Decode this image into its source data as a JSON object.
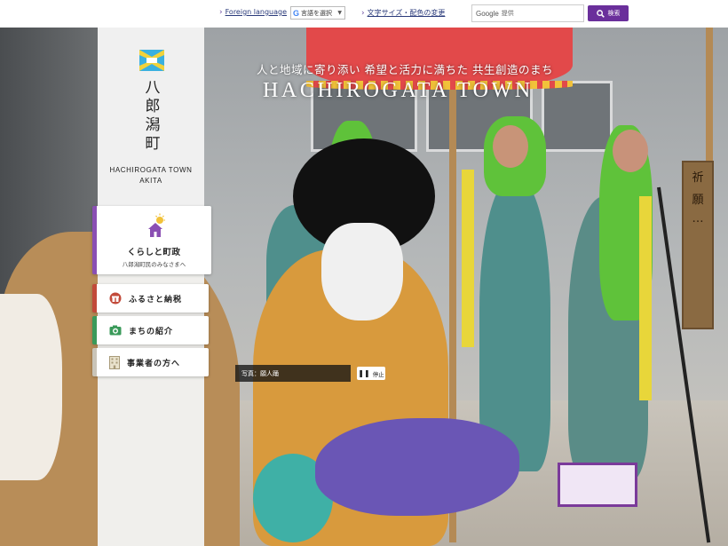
{
  "header": {
    "foreign_language": "Foreign language",
    "translate_label": "言語を選択",
    "translate_arrow": "▼",
    "accessibility_link": "文字サイズ・配色の変更",
    "search": {
      "brand": "Google",
      "placeholder": "提供",
      "button_label": "検索"
    }
  },
  "site": {
    "name_vertical": [
      "八",
      "郎",
      "潟",
      "町"
    ],
    "name_en_line1": "HACHIROGATA TOWN",
    "name_en_line2": "AKITA"
  },
  "hero": {
    "catch_jp": "人と地域に寄り添い 希望と活力に満ちた 共生創造のまち",
    "catch_en": "HACHIROGATA TOWN",
    "photo_credit": "写真：願人踊",
    "pause_label": "停止",
    "sign_text": [
      "祈",
      "願",
      "…"
    ]
  },
  "nav": {
    "main": {
      "title": "くらしと町政",
      "subtitle": "八郎潟町民のみなさまへ"
    },
    "items": [
      {
        "label": "ふるさと納税",
        "icon": "gift-icon",
        "accent": "#c24a3a"
      },
      {
        "label": "まちの紹介",
        "icon": "camera-icon",
        "accent": "#3a9a5a"
      },
      {
        "label": "事業者の方へ",
        "icon": "building-icon",
        "accent": "#c9c4b8"
      }
    ]
  },
  "colors": {
    "brand_purple": "#6a2f9b",
    "main_accent": "#8a4fb3"
  }
}
